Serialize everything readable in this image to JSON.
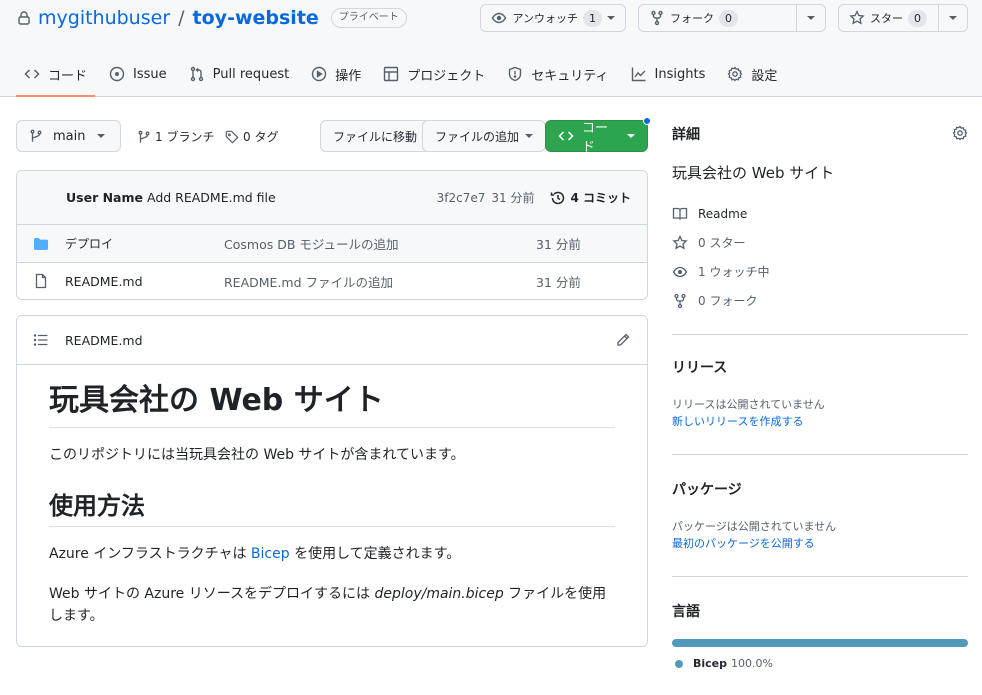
{
  "repo": {
    "owner": "mygithubuser",
    "separator": "/",
    "name": "toy-website",
    "visibility": "プライベート"
  },
  "header_actions": {
    "watch": {
      "label": "アンウォッチ",
      "count": "1",
      "icon": "eye-icon"
    },
    "fork": {
      "label": "フォーク",
      "count": "0",
      "icon": "repo-forked-icon"
    },
    "star": {
      "label": "スター",
      "count": "0",
      "icon": "star-icon"
    }
  },
  "tabs": [
    {
      "label": "コード",
      "icon": "code-icon",
      "active": true
    },
    {
      "label": "Issue",
      "icon": "issue-opened-icon"
    },
    {
      "label": "Pull request",
      "icon": "git-pull-request-icon"
    },
    {
      "label": "操作",
      "icon": "play-icon"
    },
    {
      "label": "プロジェクト",
      "icon": "table-icon"
    },
    {
      "label": "セキュリティ",
      "icon": "shield-icon"
    },
    {
      "label": "Insights",
      "icon": "graph-icon"
    },
    {
      "label": "設定",
      "icon": "gear-icon"
    }
  ],
  "toolbar": {
    "branch": "main",
    "branches": "1 ブランチ",
    "tags": "0 タグ",
    "go_to_file": "ファイルに移動",
    "add_file": "ファイルの追加",
    "code": "コード"
  },
  "latest_commit": {
    "author": "User Name",
    "message": "Add README.md file",
    "sha": "3f2c7e7",
    "age": "31 分前",
    "commits": "4 コミット"
  },
  "files": [
    {
      "type": "folder",
      "name": "デプロイ",
      "message": "Cosmos DB モジュールの追加",
      "age": "31 分前"
    },
    {
      "type": "file",
      "name": "README.md",
      "message": "README.md ファイルの追加",
      "age": "31 分前"
    }
  ],
  "readme": {
    "filename": "README.md",
    "h1": "玩具会社の Web サイト",
    "p1": "このリポジトリには当玩具会社の Web サイトが含まれています。",
    "h2": "使用方法",
    "p2_before": "Azure インフラストラクチャは ",
    "p2_link": "Bicep",
    "p2_after": " を使用して定義されます。",
    "p3_before": "Web サイトの Azure リソースをデプロイするには ",
    "p3_em": "deploy/main.bicep",
    "p3_after": " ファイルを使用します。"
  },
  "sidebar": {
    "about_title": "詳細",
    "description": "玩具会社の Web サイト",
    "meta": [
      {
        "icon": "book-icon",
        "label": "Readme"
      },
      {
        "icon": "star-icon",
        "label": "0 スター"
      },
      {
        "icon": "eye-icon",
        "label": "1 ウォッチ中"
      },
      {
        "icon": "repo-forked-icon",
        "label": "0 フォーク"
      }
    ],
    "releases": {
      "title": "リリース",
      "empty": "リリースは公開されていません",
      "link": "新しいリリースを作成する"
    },
    "packages": {
      "title": "パッケージ",
      "empty": "パッケージは公開されていません",
      "link": "最初のパッケージを公開する"
    },
    "languages": {
      "title": "言語",
      "items": [
        {
          "name": "Bicep",
          "percent": "100.0%",
          "fraction": 1.0,
          "color": "#519aba"
        }
      ]
    }
  },
  "colors": {
    "accent_link": "#0969da",
    "active_tab_underline": "#fd8c73",
    "code_button": "#2da44e",
    "bicep": "#519aba",
    "folder": "#54aeff"
  }
}
